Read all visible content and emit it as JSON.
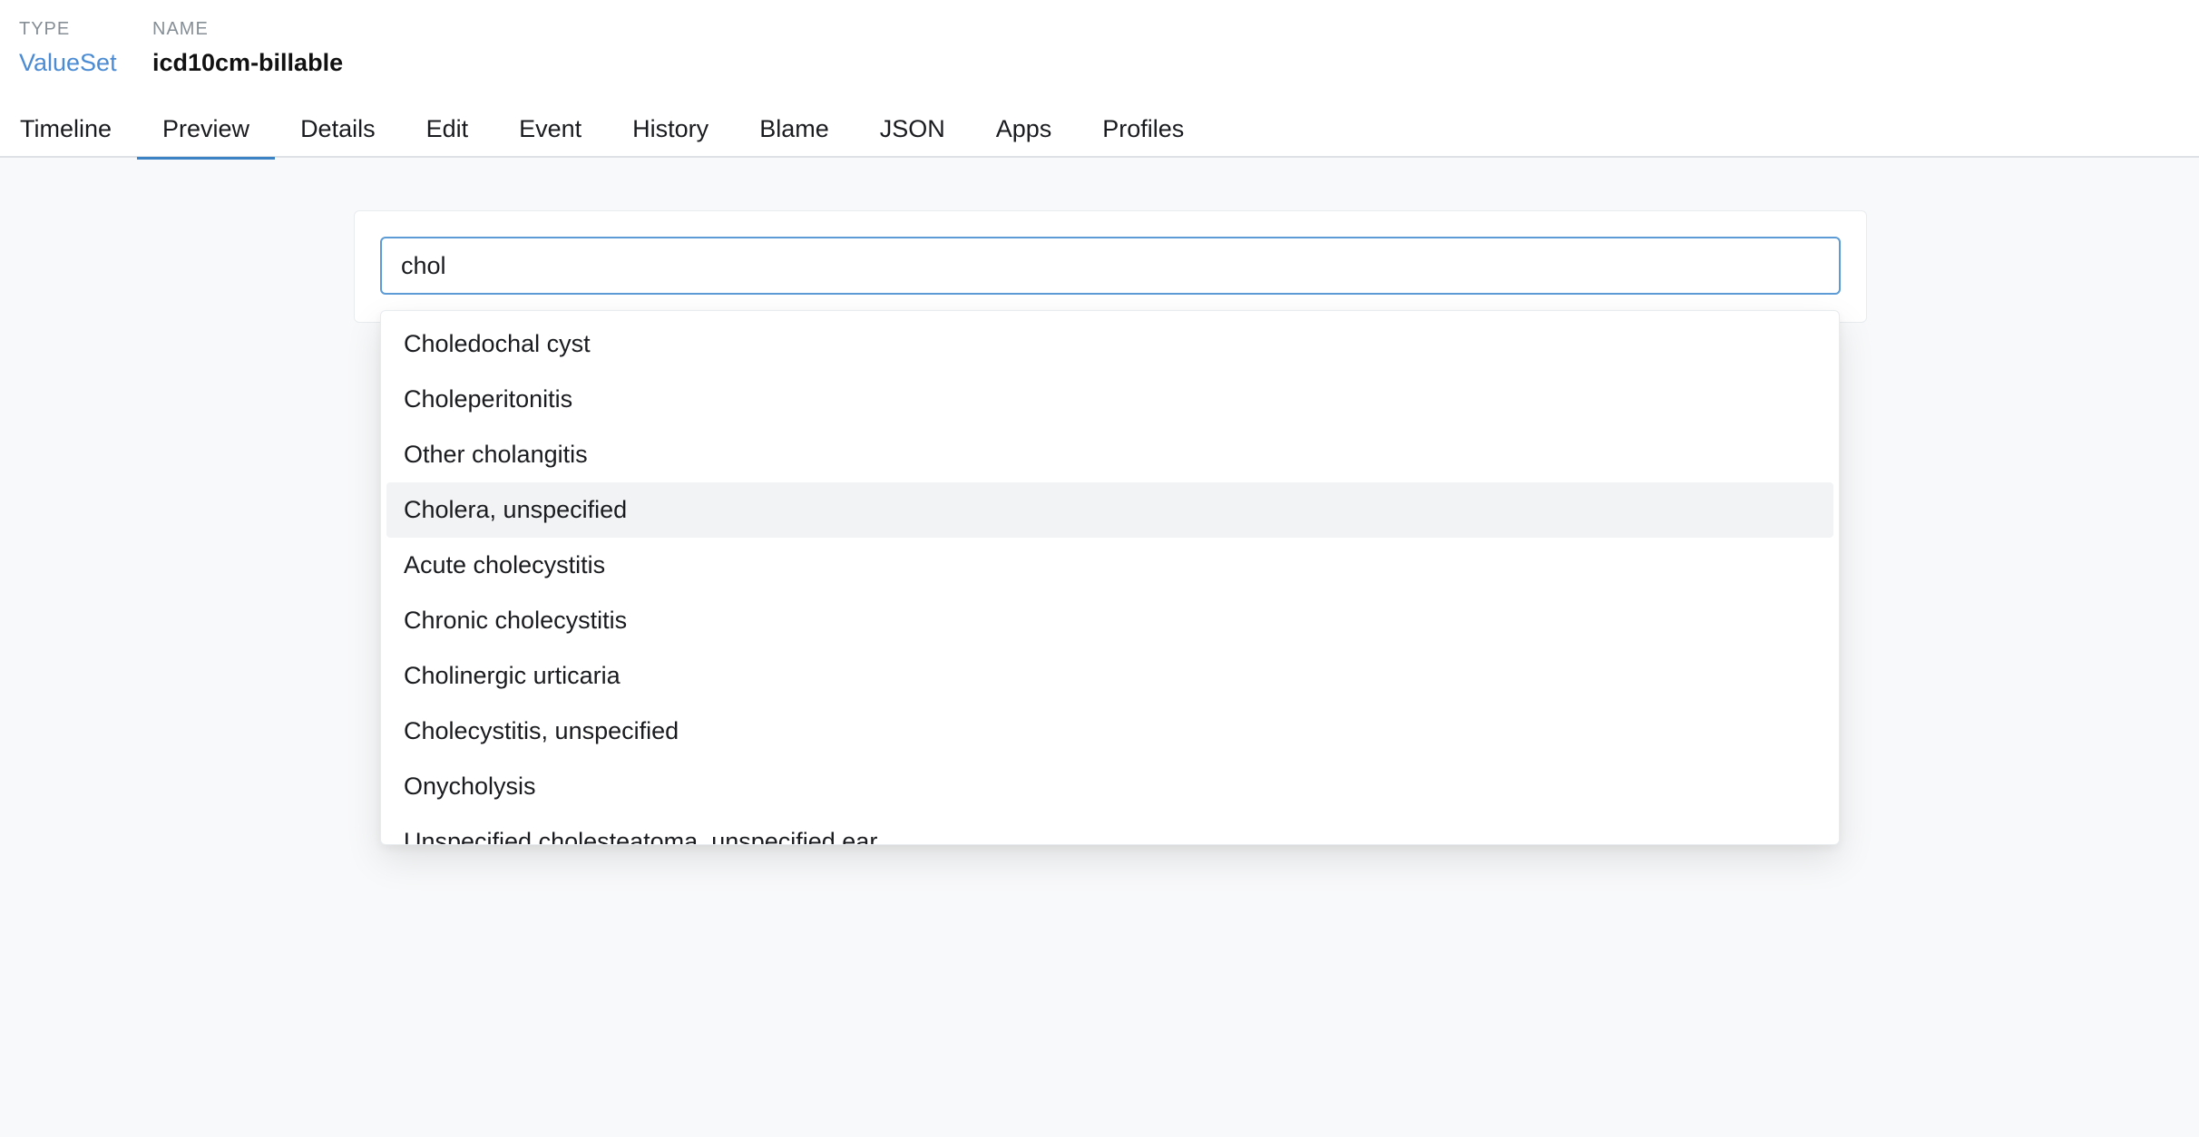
{
  "resource": {
    "type_label": "TYPE",
    "type_value": "ValueSet",
    "name_label": "NAME",
    "name_value": "icd10cm-billable"
  },
  "tabs": [
    {
      "label": "Timeline",
      "active": false
    },
    {
      "label": "Preview",
      "active": true
    },
    {
      "label": "Details",
      "active": false
    },
    {
      "label": "Edit",
      "active": false
    },
    {
      "label": "Event",
      "active": false
    },
    {
      "label": "History",
      "active": false
    },
    {
      "label": "Blame",
      "active": false
    },
    {
      "label": "JSON",
      "active": false
    },
    {
      "label": "Apps",
      "active": false
    },
    {
      "label": "Profiles",
      "active": false
    }
  ],
  "search": {
    "value": "chol"
  },
  "dropdown": {
    "highlighted_index": 3,
    "options": [
      "Choledochal cyst",
      "Choleperitonitis",
      "Other cholangitis",
      "Cholera, unspecified",
      "Acute cholecystitis",
      "Chronic cholecystitis",
      "Cholinergic urticaria",
      "Cholecystitis, unspecified",
      "Onycholysis",
      "Unspecified cholesteatoma, unspecified ear"
    ]
  },
  "colors": {
    "accent": "#3b82c4",
    "link": "#4a8bd4",
    "page_background": "#f8f9fa",
    "input_border": "#5c9bd6"
  }
}
